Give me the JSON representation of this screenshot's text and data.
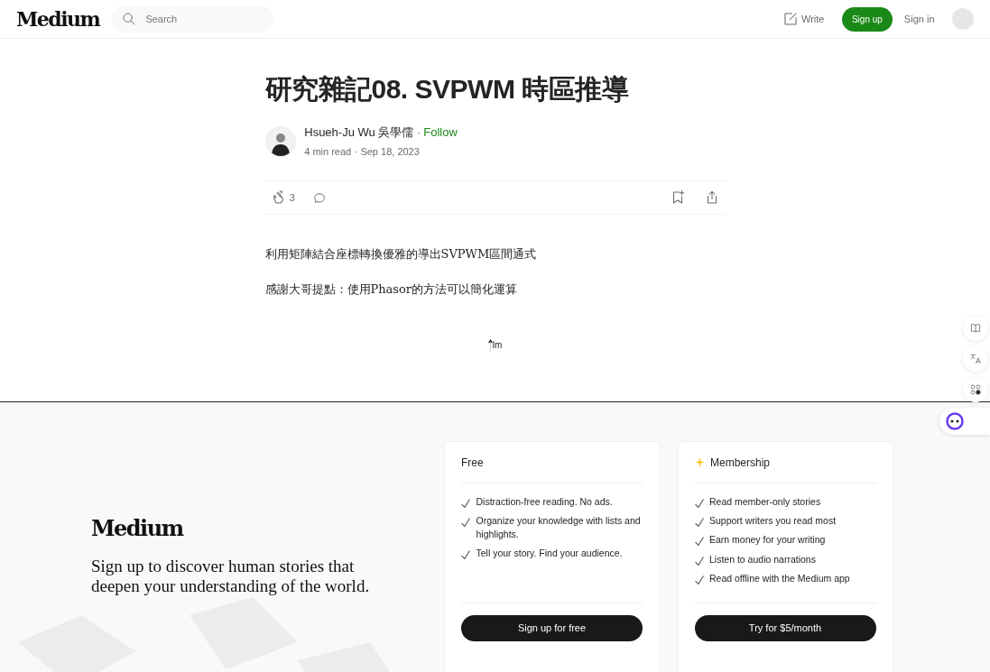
{
  "header": {
    "logo": "Medium",
    "search": {
      "placeholder": "Search"
    },
    "write": "Write",
    "sign_up": "Sign up",
    "sign_in": "Sign in"
  },
  "article": {
    "title": "研究雜記08. SVPWM 時區推導",
    "author": "Hsueh-Ju Wu 吳學儒",
    "separator": "·",
    "follow": "Follow",
    "read_time": "4 min read",
    "meta_separator": "·",
    "date": "Sep 18, 2023",
    "claps": "3",
    "paragraphs": [
      "利用矩陣結合座標轉換優雅的導出SVPWM區間通式",
      "感謝大哥提點：使用Phasor的方法可以簡化運算"
    ],
    "image_alt": "lm"
  },
  "signup": {
    "logo": "Medium",
    "tagline": "Sign up to discover human stories that deepen your understanding of the world.",
    "plans": [
      {
        "name": "Free",
        "starred": false,
        "features": [
          "Distraction-free reading. No ads.",
          "Organize your knowledge with lists and highlights.",
          "Tell your story. Find your audience."
        ],
        "button": "Sign up for free"
      },
      {
        "name": "Membership",
        "starred": true,
        "features": [
          "Read member-only stories",
          "Support writers you read most",
          "Earn money for your writing",
          "Listen to audio narrations",
          "Read offline with the Medium app"
        ],
        "button": "Try for $5/month"
      }
    ]
  }
}
